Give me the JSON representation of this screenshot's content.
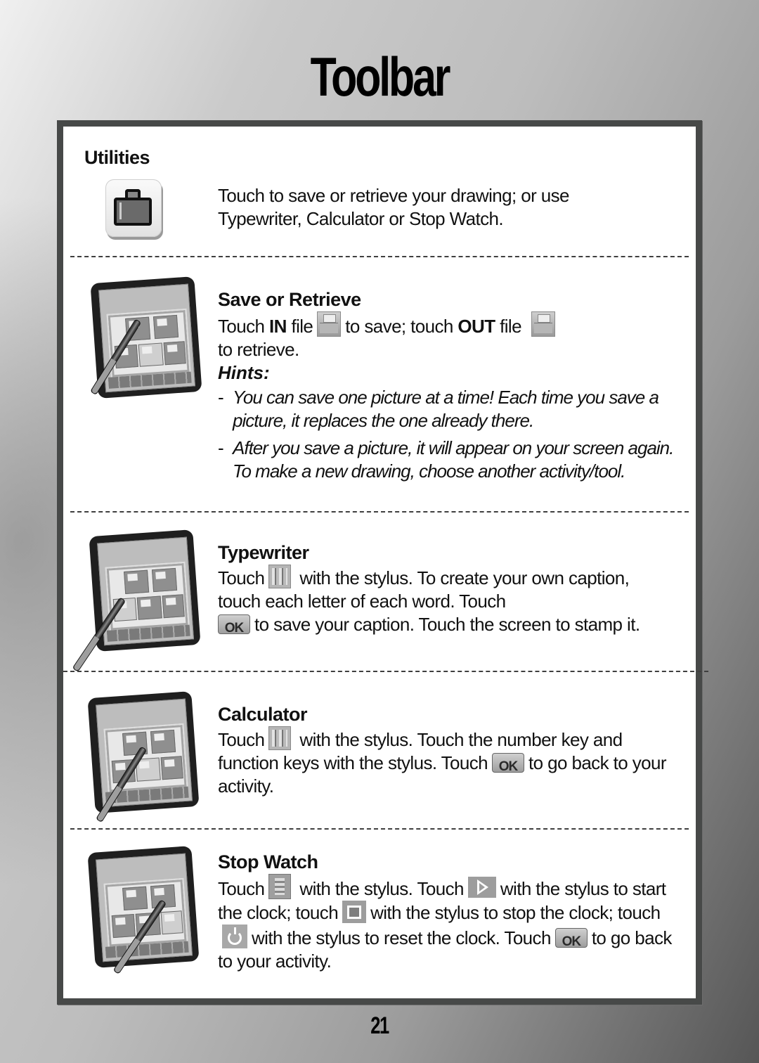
{
  "page": {
    "title": "Toolbar",
    "page_number": "21"
  },
  "utilities": {
    "heading": "Utilities",
    "icon": "briefcase-icon",
    "description": "Touch to save or retrieve your drawing; or use Typewriter, Calculator or Stop Watch."
  },
  "save_retrieve": {
    "heading": "Save or Retrieve",
    "line1_a": "Touch ",
    "line1_b": "IN",
    "line1_c": " file",
    "line1_d": "to save; touch ",
    "line1_e": "OUT",
    "line1_f": " file",
    "line2": "to retrieve.",
    "icons": [
      "in-file-icon",
      "out-file-icon"
    ],
    "hints_title": "Hints:",
    "hints": [
      "You can save one picture at a time! Each time you save a picture, it replaces the one already there.",
      "After you save a picture, it will appear on your screen again. To make a new drawing, choose another activity/tool."
    ],
    "hint_marker": "-"
  },
  "typewriter": {
    "heading": "Typewriter",
    "text_a": "Touch",
    "text_b": "with the stylus. To create your own caption, touch each letter of each word. Touch",
    "text_c": "to save your caption. Touch the screen to stamp it.",
    "icons": [
      "typewriter-icon",
      "ok-icon"
    ]
  },
  "calculator": {
    "heading": "Calculator",
    "text_a": "Touch",
    "text_b": "with the stylus.  Touch the number key and function keys with the stylus. Touch",
    "text_c": "to go back to your activity.",
    "icons": [
      "calculator-icon",
      "ok-icon"
    ]
  },
  "stopwatch": {
    "heading": "Stop Watch",
    "text_a": "Touch",
    "text_b": "with the stylus.  Touch",
    "text_c": "with the stylus to start the clock; touch",
    "text_d": "with the stylus to stop the clock; touch",
    "text_e": "with the stylus to reset the clock. Touch",
    "text_f": "to go back to your activity.",
    "icons": [
      "stopwatch-icon",
      "play-icon",
      "stop-icon",
      "reset-icon",
      "ok-icon"
    ]
  },
  "ok_label": "OK"
}
